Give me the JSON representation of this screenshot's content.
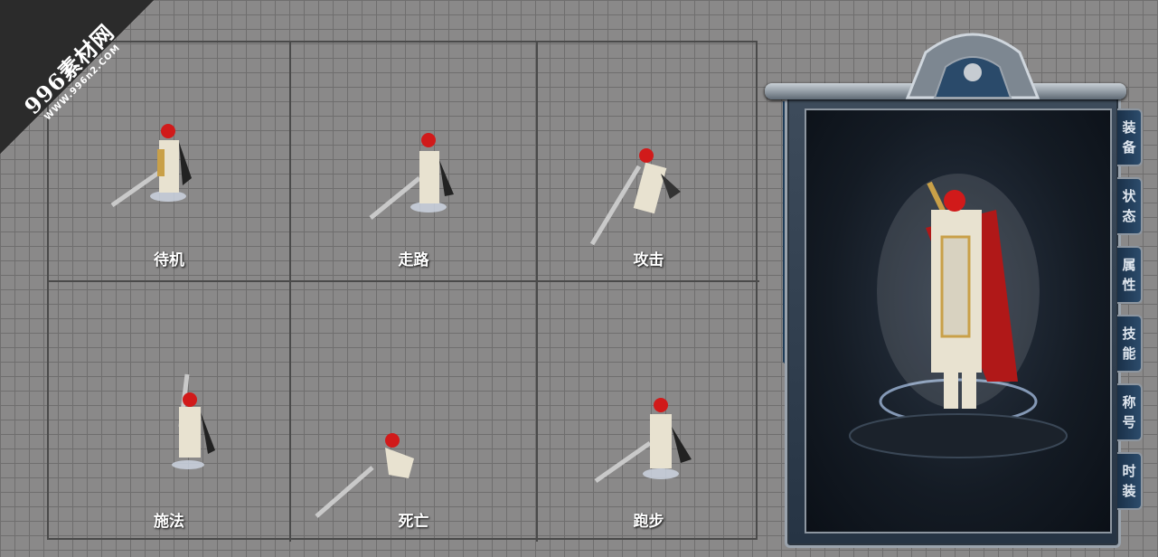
{
  "watermark": {
    "main": "996素材网",
    "sub": "WWW.996n2.COM"
  },
  "cells": [
    {
      "label": "待机"
    },
    {
      "label": "走路"
    },
    {
      "label": "攻击"
    },
    {
      "label": "施法"
    },
    {
      "label": "死亡"
    },
    {
      "label": "跑步"
    }
  ],
  "panel": {
    "tabs": [
      {
        "c1": "装",
        "c2": "备"
      },
      {
        "c1": "状",
        "c2": "态"
      },
      {
        "c1": "属",
        "c2": "性"
      },
      {
        "c1": "技",
        "c2": "能"
      },
      {
        "c1": "称",
        "c2": "号"
      },
      {
        "c1": "时",
        "c2": "装"
      }
    ]
  },
  "colors": {
    "accent": "#d11a1a",
    "armor": "#e8e2d0",
    "gold": "#c9a048",
    "frame": "#9aa3ad"
  }
}
